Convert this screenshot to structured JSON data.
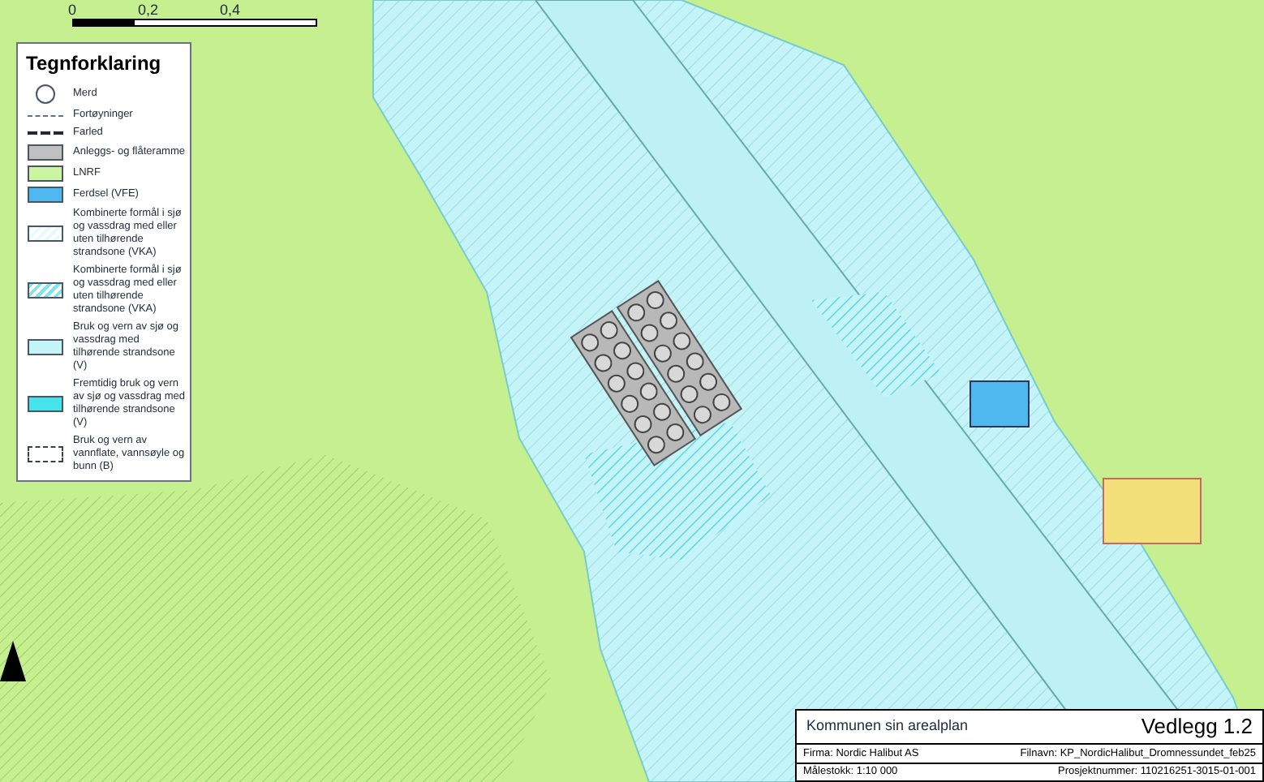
{
  "scale_bar": {
    "labels": [
      "0",
      "0,2",
      "0,4"
    ]
  },
  "legend": {
    "title": "Tegnforklaring",
    "items": [
      {
        "kind": "circle",
        "label": "Merd"
      },
      {
        "kind": "thin-dash",
        "label": "Fortøyninger"
      },
      {
        "kind": "thick-dash",
        "label": "Farled"
      },
      {
        "kind": "swatch",
        "color": "#c0c0c0",
        "label": "Anleggs- og flåteramme"
      },
      {
        "kind": "swatch",
        "color": "#ccf59f",
        "label": "LNRF"
      },
      {
        "kind": "swatch",
        "color": "#4fb8ee",
        "label": "Ferdsel (VFE)"
      },
      {
        "kind": "plain",
        "color": "#e6fbfd",
        "label": "Kombinerte formål i sjø og vassdrag med eller uten tilhørende strandsone (VKA)"
      },
      {
        "kind": "hatch",
        "color": "#7fe3f0",
        "label": "Kombinerte formål i sjø og vassdrag med eller uten tilhørende strandsone (VKA)"
      },
      {
        "kind": "swatch",
        "color": "#c4f4f8",
        "label": "Bruk og vern av sjø og vassdrag med tilhørende strandsone (V)"
      },
      {
        "kind": "swatch",
        "color": "#46e3ea",
        "label": "Fremtidig bruk og vern av sjø og vassdrag med tilhørende strandsone (V)"
      },
      {
        "kind": "dash-box",
        "label": "Bruk og vern av vannflate, vannsøyle og bunn (B)"
      }
    ]
  },
  "title_block": {
    "heading": "Kommunen sin arealplan",
    "appendix": "Vedlegg 1.2",
    "company": "Firma: Nordic Halibut AS",
    "filename": "Filnavn: KP_NordicHalibut_Dromnessundet_feb25",
    "scale": "Målestokk: 1:10 000",
    "project": "Prosjektnummer: 110216251-3015-01-001"
  }
}
